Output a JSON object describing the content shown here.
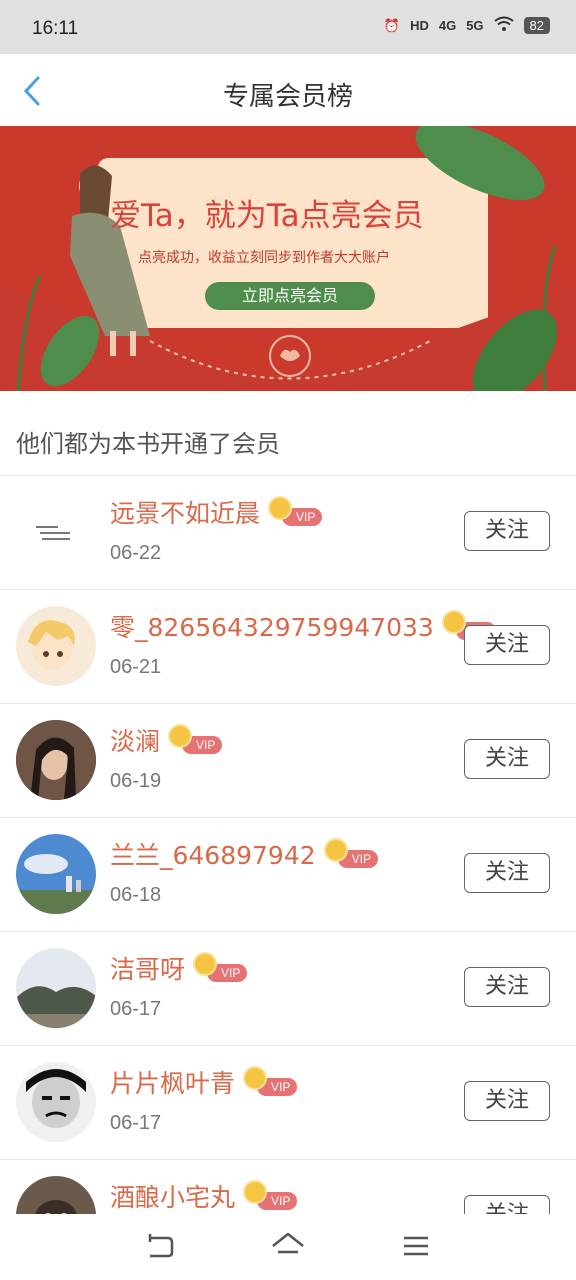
{
  "status_bar": {
    "time": "16:11",
    "signal_4g": "4G",
    "signal_5g": "5G",
    "hd": "HD",
    "battery": "82"
  },
  "header": {
    "title": "专属会员榜"
  },
  "banner": {
    "headline": "爱Ta，就为Ta点亮会员",
    "subtitle": "点亮成功，收益立刻同步到作者大大账户",
    "cta_label": "立即点亮会员",
    "colors": {
      "background": "#c9392c",
      "card": "#fde3c9",
      "button": "#4f8d4c"
    }
  },
  "section": {
    "title": "他们都为本书开通了会员"
  },
  "members": [
    {
      "name": "远景不如近晨",
      "badge": "VIP",
      "date": "06-22",
      "follow_label": "关注",
      "avatar": "text-note"
    },
    {
      "name": "零_826564329759947033",
      "badge": "VIP",
      "date": "06-21",
      "follow_label": "关注",
      "avatar": "anime-boy"
    },
    {
      "name": "淡澜",
      "badge": "VIP",
      "date": "06-19",
      "follow_label": "关注",
      "avatar": "girl-portrait"
    },
    {
      "name": "兰兰_646897942",
      "badge": "VIP",
      "date": "06-18",
      "follow_label": "关注",
      "avatar": "city-sky"
    },
    {
      "name": "洁哥呀",
      "badge": "VIP",
      "date": "06-17",
      "follow_label": "关注",
      "avatar": "landscape"
    },
    {
      "name": "片片枫叶青",
      "badge": "VIP",
      "date": "06-17",
      "follow_label": "关注",
      "avatar": "meme-face"
    },
    {
      "name": "酒酿小宅丸",
      "badge": "VIP",
      "date": "",
      "follow_label": "关注",
      "avatar": "pet"
    }
  ],
  "theme": {
    "name_color": "#d86a4a",
    "vip_color": "#e57373",
    "crown_color": "#f5c542"
  }
}
